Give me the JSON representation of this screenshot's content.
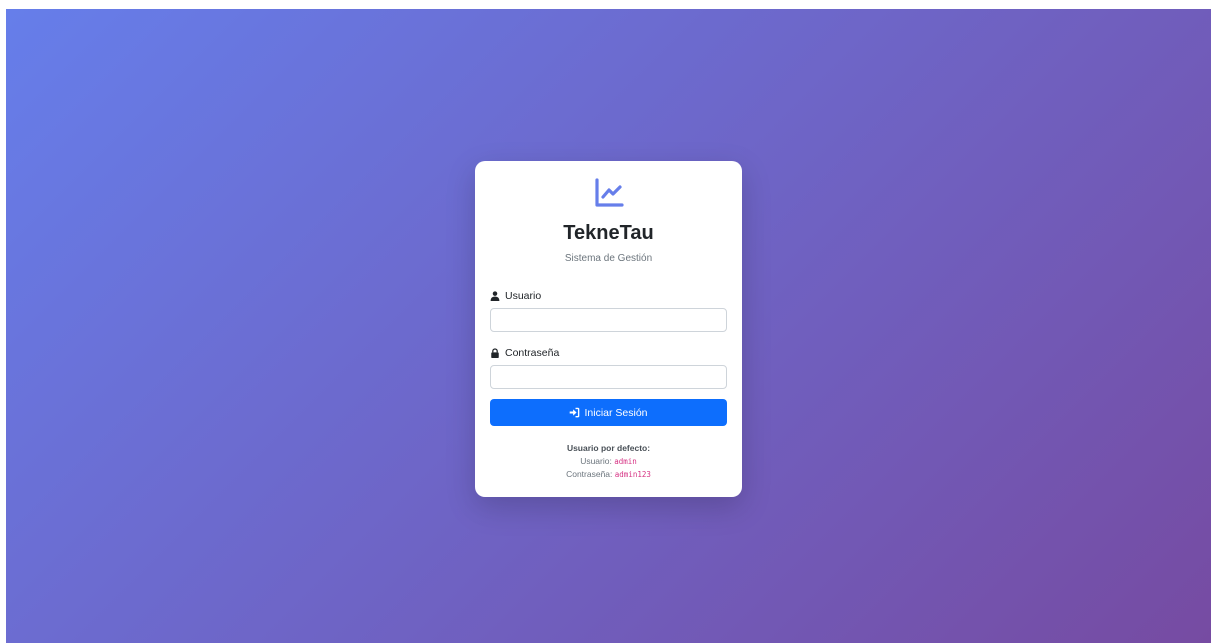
{
  "app": {
    "brand": "TekneTau",
    "subtitle": "Sistema de Gestión",
    "logo_icon": "chart-line-icon",
    "accent_color": "#667eea"
  },
  "form": {
    "username": {
      "label": "Usuario",
      "icon": "user-icon",
      "value": "",
      "placeholder": ""
    },
    "password": {
      "label": "Contraseña",
      "icon": "lock-icon",
      "value": "",
      "placeholder": ""
    },
    "submit": {
      "label": "Iniciar Sesión",
      "icon": "sign-in-icon",
      "color": "#0d6efd"
    }
  },
  "defaults": {
    "heading": "Usuario por defecto:",
    "user_label": "Usuario:",
    "user_value": "admin",
    "pass_label": "Contraseña:",
    "pass_value": "admin123"
  }
}
